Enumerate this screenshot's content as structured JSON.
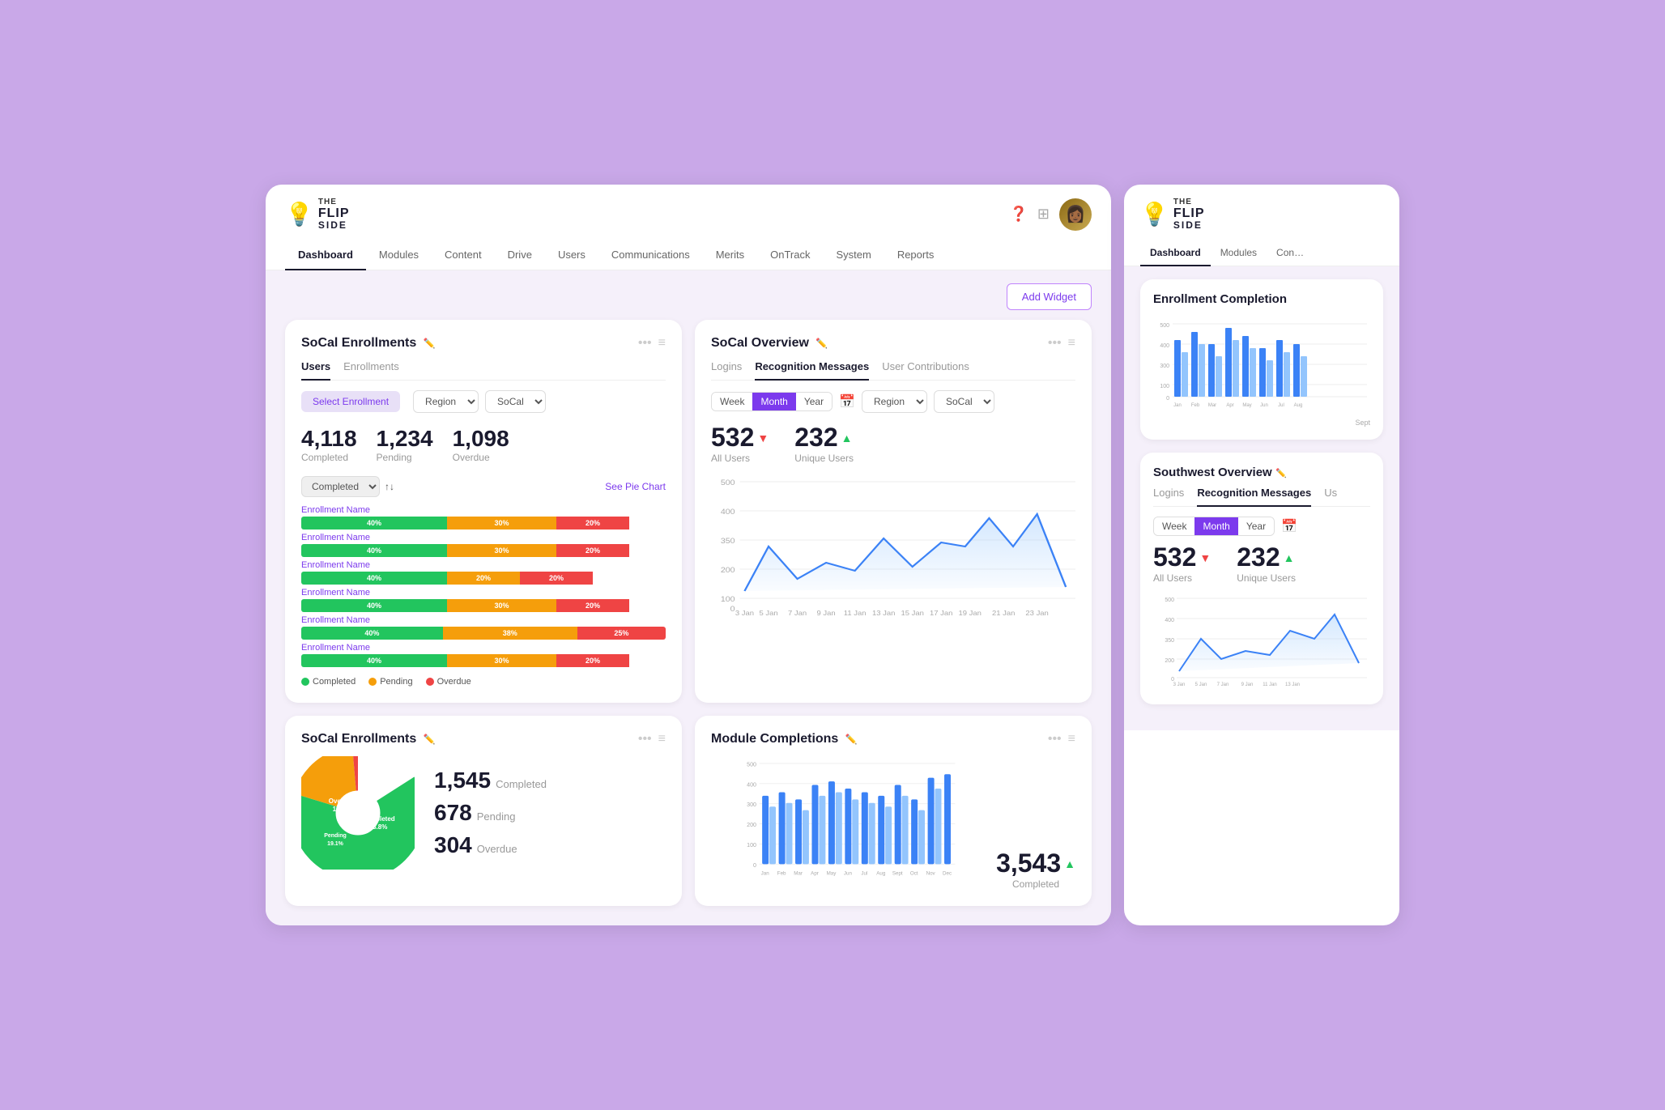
{
  "logo": {
    "the": "THE",
    "flip": "FLIP",
    "side": "SIDE",
    "icon": "💡"
  },
  "nav": {
    "items": [
      {
        "label": "Dashboard",
        "active": true
      },
      {
        "label": "Modules",
        "active": false
      },
      {
        "label": "Content",
        "active": false
      },
      {
        "label": "Drive",
        "active": false
      },
      {
        "label": "Users",
        "active": false
      },
      {
        "label": "Communications",
        "active": false
      },
      {
        "label": "Merits",
        "active": false
      },
      {
        "label": "OnTrack",
        "active": false
      },
      {
        "label": "System",
        "active": false
      },
      {
        "label": "Reports",
        "active": false
      }
    ]
  },
  "header": {
    "add_widget": "Add Widget"
  },
  "socal_enrollments": {
    "title": "SoCal Enrollments",
    "tab_users": "Users",
    "tab_enrollments": "Enrollments",
    "select_btn": "Select Enrollment",
    "region_label": "Region",
    "region_value": "SoCal",
    "completed": "4,118",
    "completed_label": "Completed",
    "pending": "1,234",
    "pending_label": "Pending",
    "overdue": "1,098",
    "overdue_label": "Overdue",
    "sort_label": "Completed",
    "see_pie": "See Pie Chart",
    "legend_completed": "Completed",
    "legend_pending": "Pending",
    "legend_overdue": "Overdue",
    "bars": [
      {
        "name": "Enrollment Name",
        "completed": 40,
        "pending": 30,
        "overdue": 20
      },
      {
        "name": "Enrollment Name",
        "completed": 40,
        "pending": 30,
        "overdue": 20
      },
      {
        "name": "Enrollment Name",
        "completed": 40,
        "pending": 20,
        "overdue": 20
      },
      {
        "name": "Enrollment Name",
        "completed": 40,
        "pending": 30,
        "overdue": 20
      },
      {
        "name": "Enrollment Name",
        "completed": 40,
        "pending": 38,
        "overdue": 25
      },
      {
        "name": "Enrollment Name",
        "completed": 40,
        "pending": 30,
        "overdue": 20
      }
    ]
  },
  "socal_overview": {
    "title": "SoCal Overview",
    "tab_logins": "Logins",
    "tab_recognition": "Recognition Messages",
    "tab_contributions": "User Contributions",
    "period_week": "Week",
    "period_month": "Month",
    "period_year": "Year",
    "region_label": "Region",
    "region_value": "SoCal",
    "all_users": "532",
    "all_users_label": "All Users",
    "unique_users": "232",
    "unique_users_label": "Unique Users",
    "y_labels": [
      "500",
      "400",
      "350",
      "200",
      "100",
      "0"
    ],
    "x_labels": [
      "3 Jan",
      "5 Jan",
      "7 Jan",
      "9 Jan",
      "11 Jan",
      "13 Jan",
      "15 Jan",
      "17 Jan",
      "19 Jan",
      "21 Jan",
      "23 Jan"
    ]
  },
  "socal_enrollments_pie": {
    "title": "SoCal Enrollments",
    "completed": "1,545",
    "completed_label": "Completed",
    "pending": "678",
    "pending_label": "Pending",
    "overdue": "304",
    "overdue_label": "Overdue",
    "pie_completed_pct": "63.8%",
    "pie_pending_pct": "19.1%",
    "pie_overdue_pct": "17.0%"
  },
  "module_completions": {
    "title": "Module Completions",
    "completed_num": "3,543",
    "completed_label": "Completed",
    "months": [
      "Jan",
      "Feb",
      "Mar",
      "Apr",
      "May",
      "Jun",
      "Jul",
      "Aug",
      "Sept",
      "Oct",
      "Nov",
      "Dec"
    ],
    "y_labels": [
      "500",
      "400",
      "300",
      "200",
      "100",
      "0"
    ]
  },
  "side_panel": {
    "enrollment_completion_title": "Enrollment Completion",
    "southwest_overview_title": "Southwest Overview",
    "tab_logins": "Logins",
    "tab_recognition": "Recognition Messages",
    "tab_contributions": "Us",
    "period_week": "Week",
    "period_month": "Month",
    "period_year": "Year",
    "all_users": "532",
    "all_users_label": "All Users",
    "unique_users": "232",
    "unique_users_label": "Unique Users",
    "y_labels": [
      "500",
      "400",
      "350",
      "200",
      "100",
      "0"
    ],
    "x_labels": [
      "3 Jan",
      "5 Jan",
      "7 Jan",
      "9 Jan",
      "11 Jan",
      "13 Jan"
    ]
  }
}
